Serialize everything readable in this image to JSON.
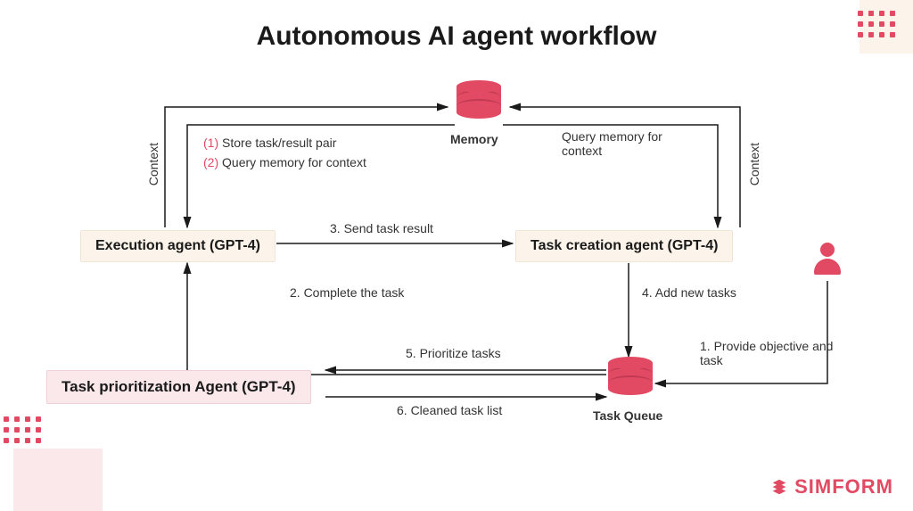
{
  "title": "Autonomous AI agent workflow",
  "nodes": {
    "memory_label": "Memory",
    "execution_agent": "Execution agent (GPT-4)",
    "task_creation_agent": "Task creation agent (GPT-4)",
    "task_prioritization_agent": "Task prioritization Agent (GPT-4)",
    "task_queue_label": "Task Queue"
  },
  "edges": {
    "context_left": "Context",
    "context_right": "Context",
    "memory_left_line1_num": "(1)",
    "memory_left_line1_text": " Store task/result pair",
    "memory_left_line2_num": "(2)",
    "memory_left_line2_text": " Query memory for context",
    "memory_right": "Query memory for context",
    "step1": "1. Provide objective and task",
    "step2": "2. Complete the task",
    "step3": "3. Send task result",
    "step4": "4. Add new tasks",
    "step5": "5. Prioritize tasks",
    "step6": "6. Cleaned task list"
  },
  "logo": "SIMFORM"
}
